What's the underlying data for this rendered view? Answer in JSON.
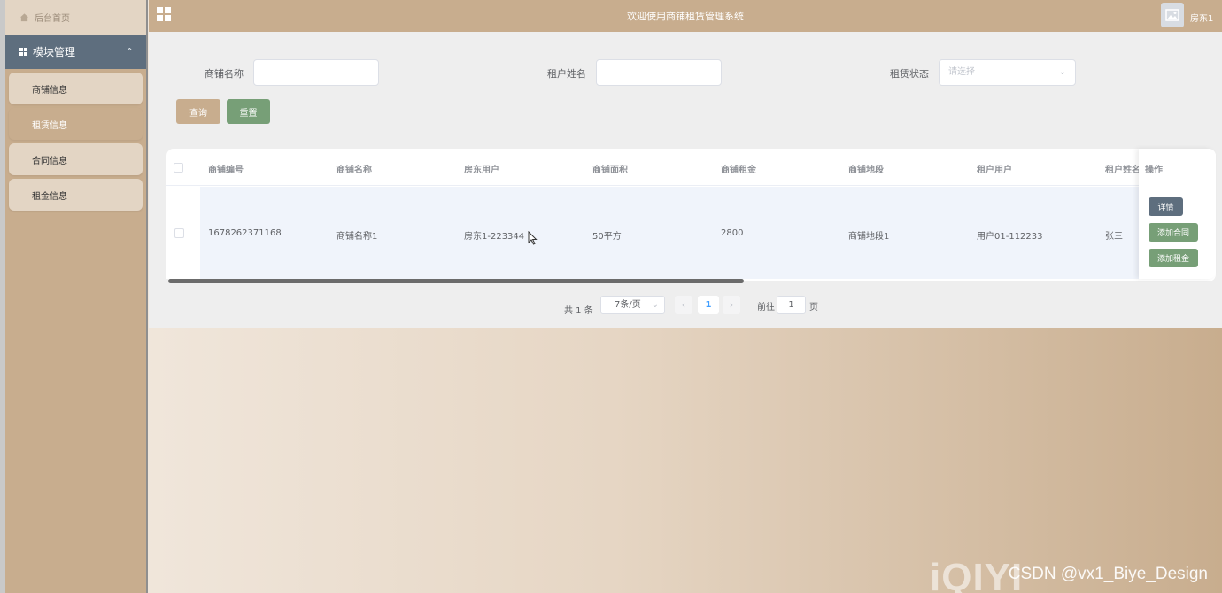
{
  "sidebar": {
    "home": "后台首页",
    "module": "模块管理",
    "items": [
      {
        "label": "商铺信息"
      },
      {
        "label": "租赁信息"
      },
      {
        "label": "合同信息"
      },
      {
        "label": "租金信息"
      }
    ]
  },
  "topbar": {
    "title": "欢迎使用商铺租赁管理系统",
    "user": "房东1"
  },
  "filters": {
    "shop_name_label": "商铺名称",
    "tenant_name_label": "租户姓名",
    "status_label": "租赁状态",
    "status_placeholder": "请选择",
    "query_button": "查询",
    "reset_button": "重置"
  },
  "table": {
    "columns": [
      "商铺编号",
      "商铺名称",
      "房东用户",
      "商铺面积",
      "商铺租金",
      "商铺地段",
      "租户用户",
      "租户姓名"
    ],
    "op_header": "操作",
    "rows": [
      {
        "cells": [
          "1678262371168",
          "商铺名称1",
          "房东1-223344",
          "50平方",
          "2800",
          "商铺地段1",
          "用户01-112233",
          "张三"
        ],
        "actions": {
          "detail": "详情",
          "add_contract": "添加合同",
          "add_rent": "添加租金"
        }
      }
    ]
  },
  "pagination": {
    "total": "共 1 条",
    "page_size": "7条/页",
    "current_page": "1",
    "goto_label": "前往",
    "goto_value": "1",
    "page_suffix": "页"
  },
  "watermark": {
    "logo": "iQIYI",
    "text": "CSDN @vx1_Biye_Design"
  },
  "colors": {
    "accent": "#c8ad8e",
    "sidebar_header": "#5e6e7e",
    "green": "#779f77"
  }
}
